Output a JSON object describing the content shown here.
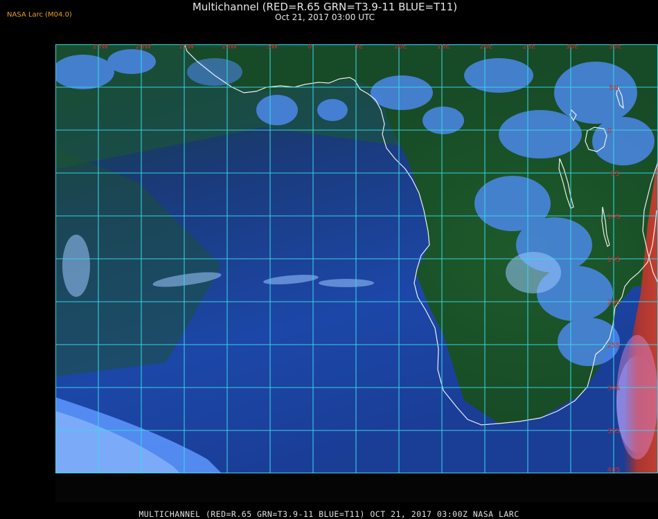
{
  "header": {
    "logo_text": "NASA Larc (M04.0)",
    "title": "Multichannel (RED=R.65 GRN=T3.9-11 BLUE=T11)",
    "subtitle": "Oct 21, 2017 03:00 UTC"
  },
  "map": {
    "longitude_labels": [
      "25W",
      "20W",
      "15W",
      "10W",
      "5W",
      "0",
      "5E",
      "10E",
      "15E",
      "20E",
      "25E",
      "30E",
      "35E"
    ],
    "latitude_labels": [
      "5N",
      "0",
      "5S",
      "10S",
      "15S",
      "20S",
      "25S",
      "30S",
      "35S",
      "40S"
    ],
    "colors": {
      "grid": "#38d8e8",
      "coastline": "#f0f0f0",
      "labels": "#d42a2a",
      "ocean": "#1a3f9e",
      "cloud": "#5a96ff",
      "land_dark": "#1c5a24"
    }
  },
  "footer": {
    "caption": "MULTICHANNEL (RED=R.65 GRN=T3.9-11 BLUE=T11) OCT 21, 2017 03:00Z   NASA LARC"
  }
}
